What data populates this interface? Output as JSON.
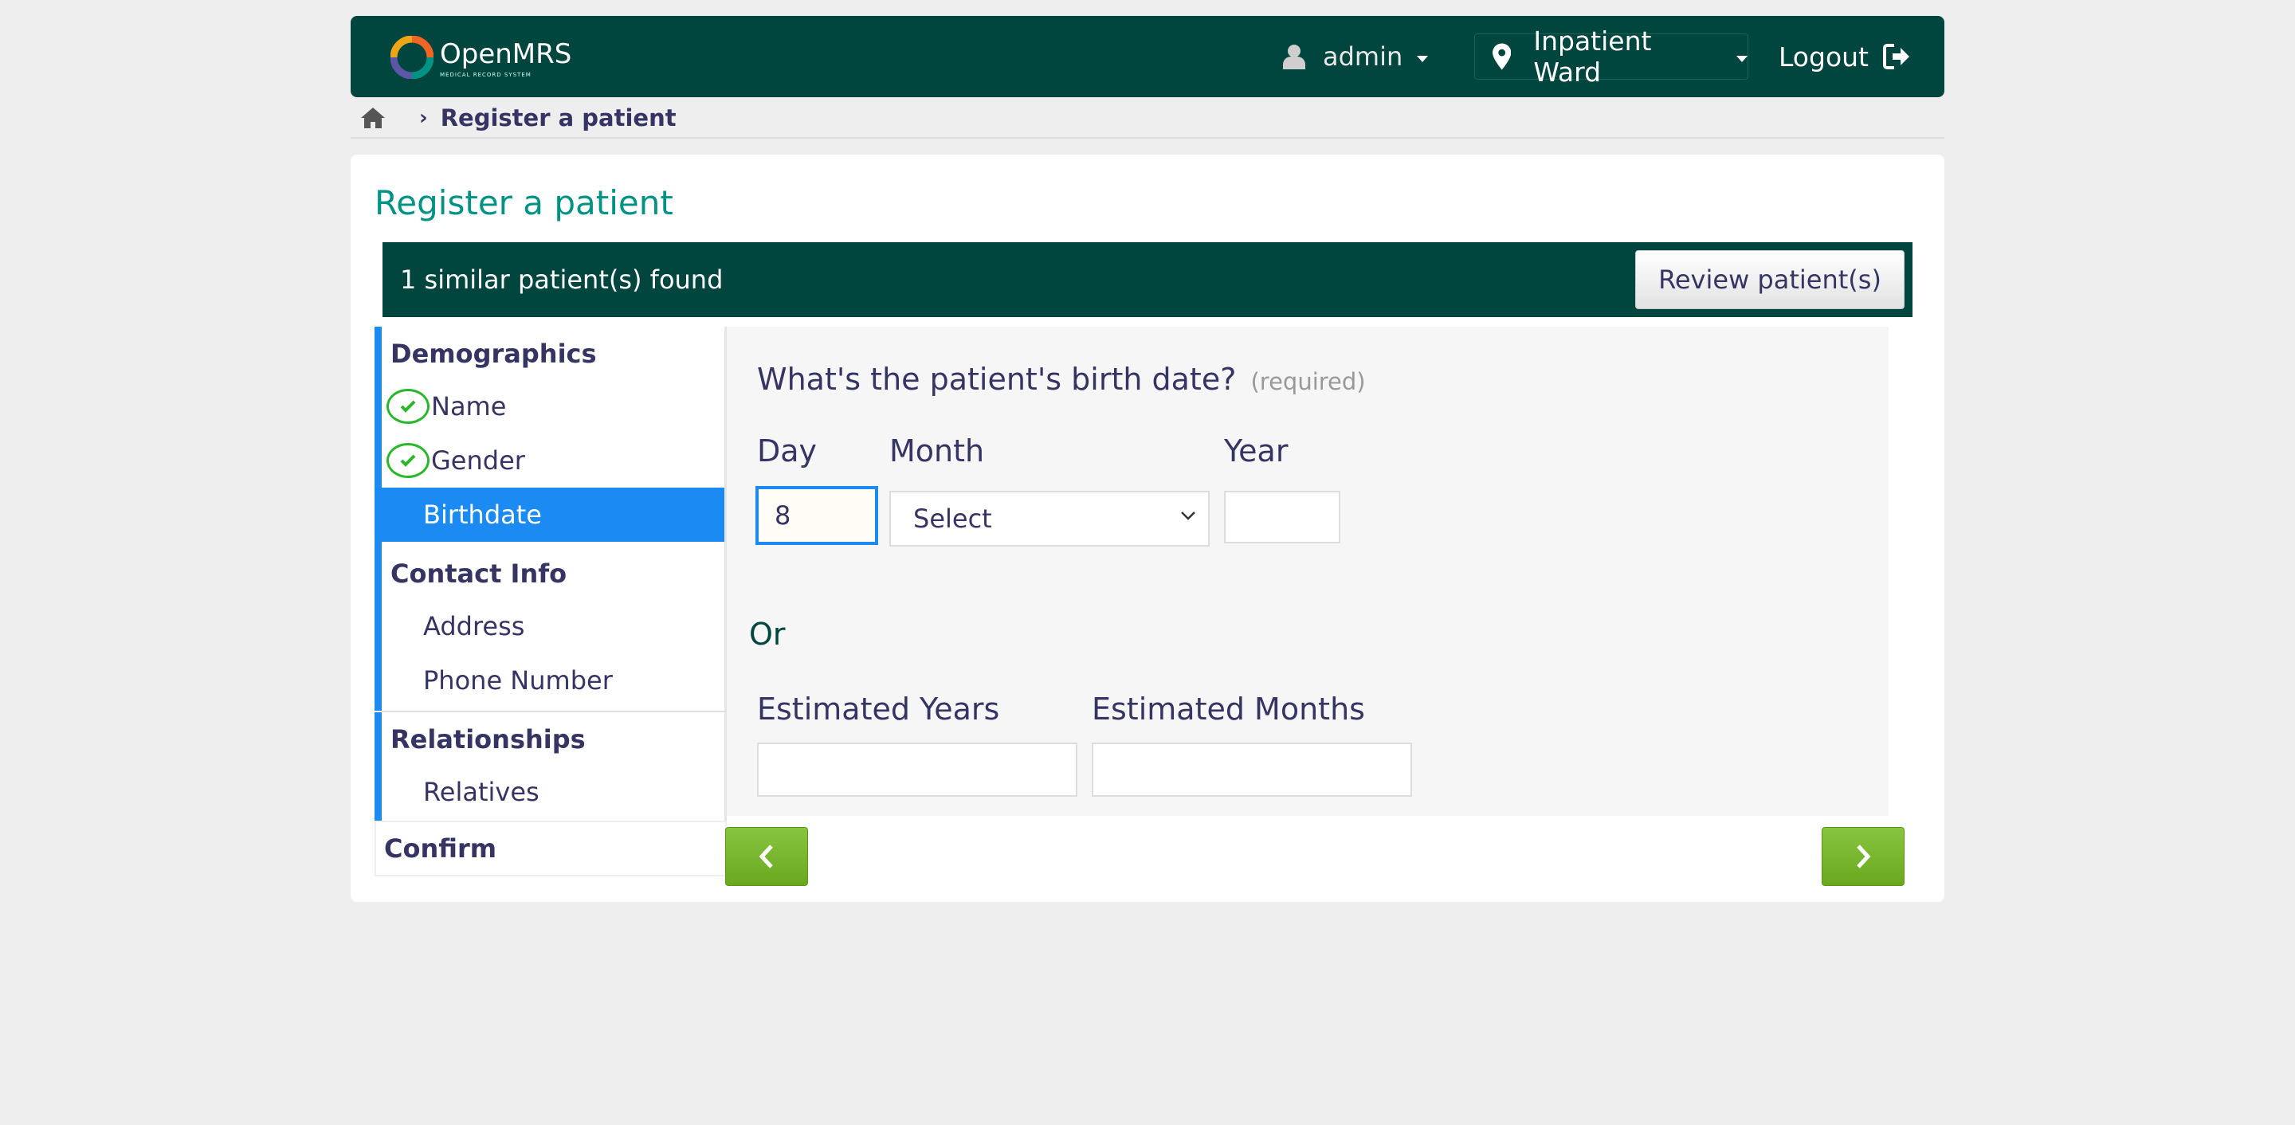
{
  "header": {
    "logo_text": "OpenMRS",
    "logo_subtext": "MEDICAL RECORD SYSTEM",
    "user": "admin",
    "location": "Inpatient Ward",
    "logout": "Logout"
  },
  "breadcrumb": {
    "current": "Register a patient"
  },
  "page": {
    "title": "Register a patient"
  },
  "similar": {
    "text": "1 similar patient(s) found",
    "button": "Review patient(s)"
  },
  "nav": {
    "demographics": {
      "heading": "Demographics",
      "items": [
        {
          "label": "Name",
          "state": "complete"
        },
        {
          "label": "Gender",
          "state": "complete"
        },
        {
          "label": "Birthdate",
          "state": "active"
        }
      ]
    },
    "contact": {
      "heading": "Contact Info",
      "items": [
        {
          "label": "Address"
        },
        {
          "label": "Phone Number"
        }
      ]
    },
    "relationships": {
      "heading": "Relationships",
      "items": [
        {
          "label": "Relatives"
        }
      ]
    },
    "confirm": "Confirm"
  },
  "form": {
    "question": "What's the patient's birth date?",
    "required_note": "(required)",
    "day_label": "Day",
    "day_value": "8",
    "month_label": "Month",
    "month_value": "Select",
    "year_label": "Year",
    "year_value": "",
    "or_text": "Or",
    "est_years_label": "Estimated Years",
    "est_years_value": "",
    "est_months_label": "Estimated Months",
    "est_months_value": ""
  },
  "icons": {
    "user": "user-icon",
    "location": "map-marker-icon",
    "logout": "logout-icon",
    "home": "home-icon",
    "check": "check-circle-icon",
    "prev": "chevron-left-icon",
    "next": "chevron-right-icon"
  },
  "colors": {
    "header_bg": "#00463f",
    "accent_title": "#009384",
    "nav_accent": "#1b8af3",
    "button_green": "#7ab72f",
    "check_green": "#2bb72b"
  }
}
